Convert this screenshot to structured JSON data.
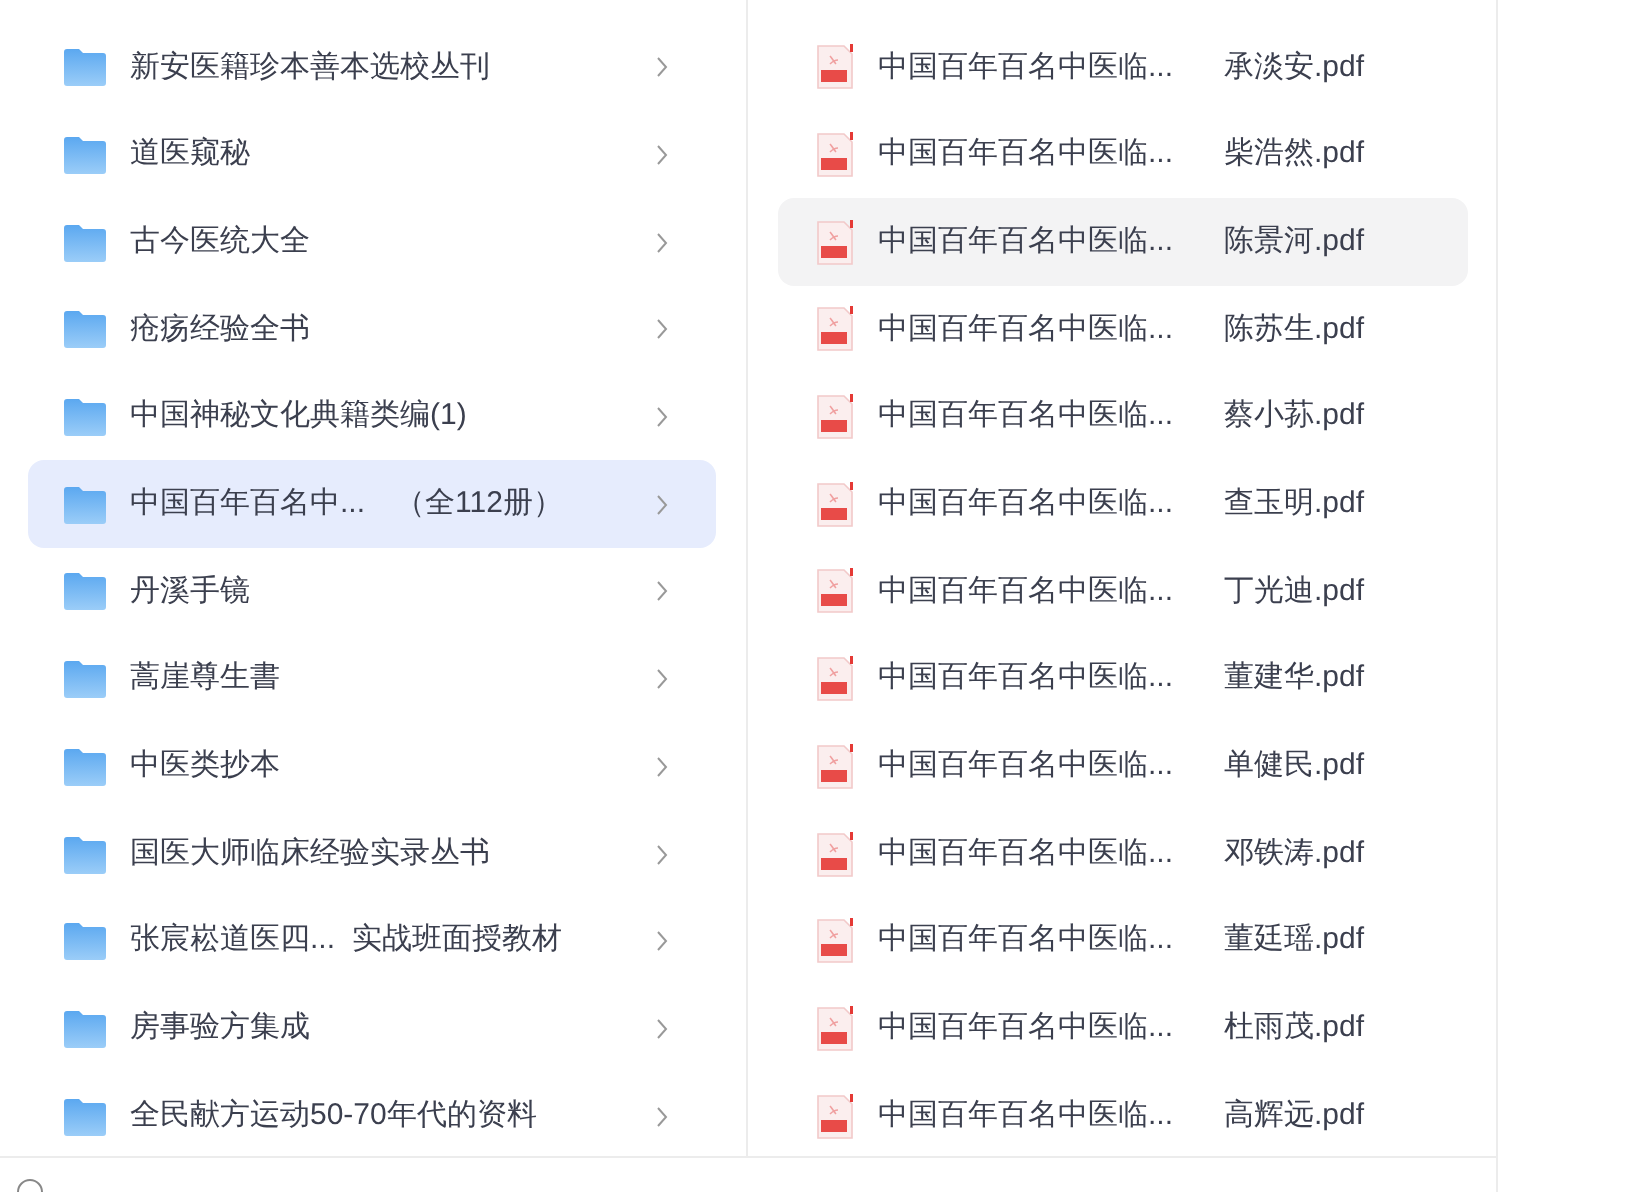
{
  "folders": [
    {
      "label": "新安医籍珍本善本选校丛刊",
      "selected": false
    },
    {
      "label": "道医窥秘",
      "selected": false
    },
    {
      "label": "古今医统大全",
      "selected": false
    },
    {
      "label": "疮疡经验全书",
      "selected": false
    },
    {
      "label": "中国神秘文化典籍类编(1)",
      "selected": false
    },
    {
      "label": "中国百年百名中...　（全112册）",
      "selected": true
    },
    {
      "label": "丹溪手镜",
      "selected": false
    },
    {
      "label": "蒿崖尊生書",
      "selected": false
    },
    {
      "label": "中医类抄本",
      "selected": false
    },
    {
      "label": "国医大师临床经验实录丛书",
      "selected": false
    },
    {
      "label": "张宸崧道医四...  实战班面授教材",
      "selected": false
    },
    {
      "label": "房事验方集成",
      "selected": false
    },
    {
      "label": "全民献方运动50-70年代的资料",
      "selected": false
    }
  ],
  "files": [
    {
      "prefix": "中国百年百名中医临...",
      "name": "承淡安.pdf",
      "selected": false
    },
    {
      "prefix": "中国百年百名中医临...",
      "name": "柴浩然.pdf",
      "selected": false
    },
    {
      "prefix": "中国百年百名中医临...",
      "name": "陈景河.pdf",
      "selected": true
    },
    {
      "prefix": "中国百年百名中医临...",
      "name": "陈苏生.pdf",
      "selected": false
    },
    {
      "prefix": "中国百年百名中医临...",
      "name": "蔡小荪.pdf",
      "selected": false
    },
    {
      "prefix": "中国百年百名中医临...",
      "name": "查玉明.pdf",
      "selected": false
    },
    {
      "prefix": "中国百年百名中医临...",
      "name": "丁光迪.pdf",
      "selected": false
    },
    {
      "prefix": "中国百年百名中医临...",
      "name": "董建华.pdf",
      "selected": false
    },
    {
      "prefix": "中国百年百名中医临...",
      "name": "单健民.pdf",
      "selected": false
    },
    {
      "prefix": "中国百年百名中医临...",
      "name": "邓铁涛.pdf",
      "selected": false
    },
    {
      "prefix": "中国百年百名中医临...",
      "name": "董廷瑶.pdf",
      "selected": false
    },
    {
      "prefix": "中国百年百名中医临...",
      "name": "杜雨茂.pdf",
      "selected": false
    },
    {
      "prefix": "中国百年百名中医临...",
      "name": "高辉远.pdf",
      "selected": false
    }
  ]
}
